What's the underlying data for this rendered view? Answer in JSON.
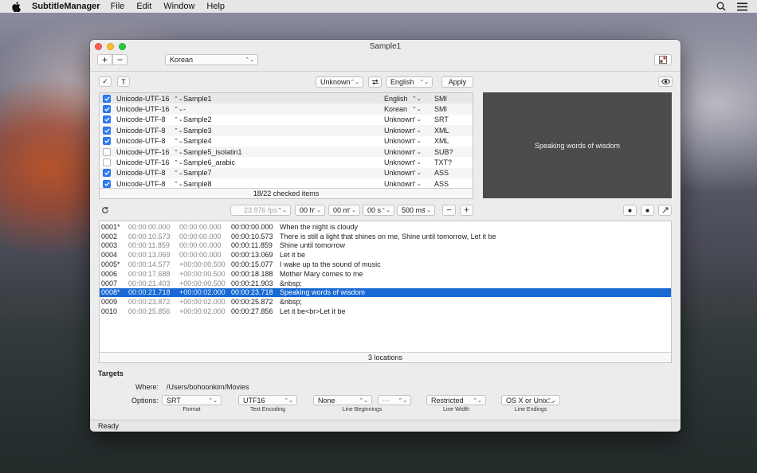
{
  "menubar": {
    "app_name": "SubtitleManager",
    "menus": [
      "File",
      "Edit",
      "Window",
      "Help"
    ]
  },
  "window": {
    "title": "Sample1",
    "add_label": "+",
    "remove_label": "−",
    "language_popup": "Korean"
  },
  "toolbar2": {
    "check_label": "✓",
    "text_label": "T",
    "source_encoding": "Unknown",
    "target_language": "English",
    "apply_label": "Apply"
  },
  "files": {
    "rows": [
      {
        "checked": true,
        "encoding": "Unicode-UTF-16",
        "name": "Sample1",
        "language": "English",
        "format": "SMI"
      },
      {
        "checked": true,
        "encoding": "Unicode-UTF-16",
        "name": "-",
        "language": "Korean",
        "format": "SMI"
      },
      {
        "checked": true,
        "encoding": "Unicode-UTF-8",
        "name": "Sample2",
        "language": "Unknown",
        "format": "SRT"
      },
      {
        "checked": true,
        "encoding": "Unicode-UTF-8",
        "name": "Sample3",
        "language": "Unknown",
        "format": "XML"
      },
      {
        "checked": true,
        "encoding": "Unicode-UTF-8",
        "name": "Sample4",
        "language": "Unknown",
        "format": "XML"
      },
      {
        "checked": false,
        "encoding": "Unicode-UTF-16",
        "name": "Sample5_isolatin1",
        "language": "Unknown",
        "format": "SUB?"
      },
      {
        "checked": false,
        "encoding": "Unicode-UTF-16",
        "name": "Sample6_arabic",
        "language": "Unknown",
        "format": "TXT?"
      },
      {
        "checked": true,
        "encoding": "Unicode-UTF-8",
        "name": "Sample7",
        "language": "Unknown",
        "format": "ASS"
      },
      {
        "checked": true,
        "encoding": "Unicode-UTF-8",
        "name": "Sample8",
        "language": "Unknown",
        "format": "ASS"
      }
    ],
    "footer": "18/22 checked items"
  },
  "preview": {
    "text": "Speaking words of wisdom"
  },
  "timing": {
    "fps": "23.976 fps",
    "hours": "00 h",
    "minutes": "00 m",
    "seconds": "00 s",
    "milliseconds": "500 ms",
    "minus_label": "−",
    "plus_label": "+"
  },
  "subtitles": {
    "rows": [
      {
        "id": "0001*",
        "start": "00:00:00.000",
        "duration": "00:00:00.000",
        "end": "00:00:00.000",
        "text": "When the night is cloudy",
        "selected": false
      },
      {
        "id": "0002",
        "start": "00:00:10.573",
        "duration": "00:00:00.000",
        "end": "00:00:10.573",
        "text": "There is still a light that shines on me, Shine until tomorrow, Let it be",
        "selected": false
      },
      {
        "id": "0003",
        "start": "00:00:11.859",
        "duration": "00:00:00.000",
        "end": "00:00:11.859",
        "text": "Shine until tomorrow",
        "selected": false
      },
      {
        "id": "0004",
        "start": "00:00:13.069",
        "duration": "00:00:00.000",
        "end": "00:00:13.069",
        "text": "Let it be",
        "selected": false
      },
      {
        "id": "0005*",
        "start": "00:00:14.577",
        "duration": "+00:00:00.500",
        "end": "00:00:15.077",
        "text": "I wake up to the sound of music",
        "selected": false
      },
      {
        "id": "0006",
        "start": "00:00:17.688",
        "duration": "+00:00:00.500",
        "end": "00:00:18.188",
        "text": "Mother Mary comes to me",
        "selected": false
      },
      {
        "id": "0007",
        "start": "00:00:21.403",
        "duration": "+00:00:00.500",
        "end": "00:00:21.903",
        "text": "&nbsp;",
        "selected": false
      },
      {
        "id": "0008*",
        "start": "00:00:21.718",
        "duration": "+00:00:02.000",
        "end": "00:00:23.718",
        "text": "Speaking words of wisdom",
        "selected": true
      },
      {
        "id": "0009",
        "start": "00:00:23.872",
        "duration": "+00:00:02.000",
        "end": "00:00:25.872",
        "text": "&nbsp;",
        "selected": false
      },
      {
        "id": "0010",
        "start": "00:00:25.856",
        "duration": "+00:00:02.000",
        "end": "00:00:27.856",
        "text": "Let it be<br>Let it be",
        "selected": false
      }
    ],
    "footer": "3 locations"
  },
  "targets": {
    "heading": "Targets",
    "where_label": "Where:",
    "where_value": "/Users/bohoonkim/Movies",
    "options_label": "Options:",
    "format": {
      "value": "SRT",
      "caption": "Format"
    },
    "encoding": {
      "value": "UTF16",
      "caption": "Text Encoding"
    },
    "line_beginnings": {
      "value": "None",
      "secondary": "---",
      "caption": "Line Beginnings"
    },
    "line_width": {
      "value": "Restricted",
      "caption": "Line Width"
    },
    "line_endings": {
      "value": "OS X or Unix...",
      "caption": "Line Endings"
    }
  },
  "status": {
    "text": "Ready"
  },
  "colors": {
    "selection": "#1769d4",
    "checkbox": "#2e7bf6",
    "preview_bg": "#4b4b4b"
  }
}
